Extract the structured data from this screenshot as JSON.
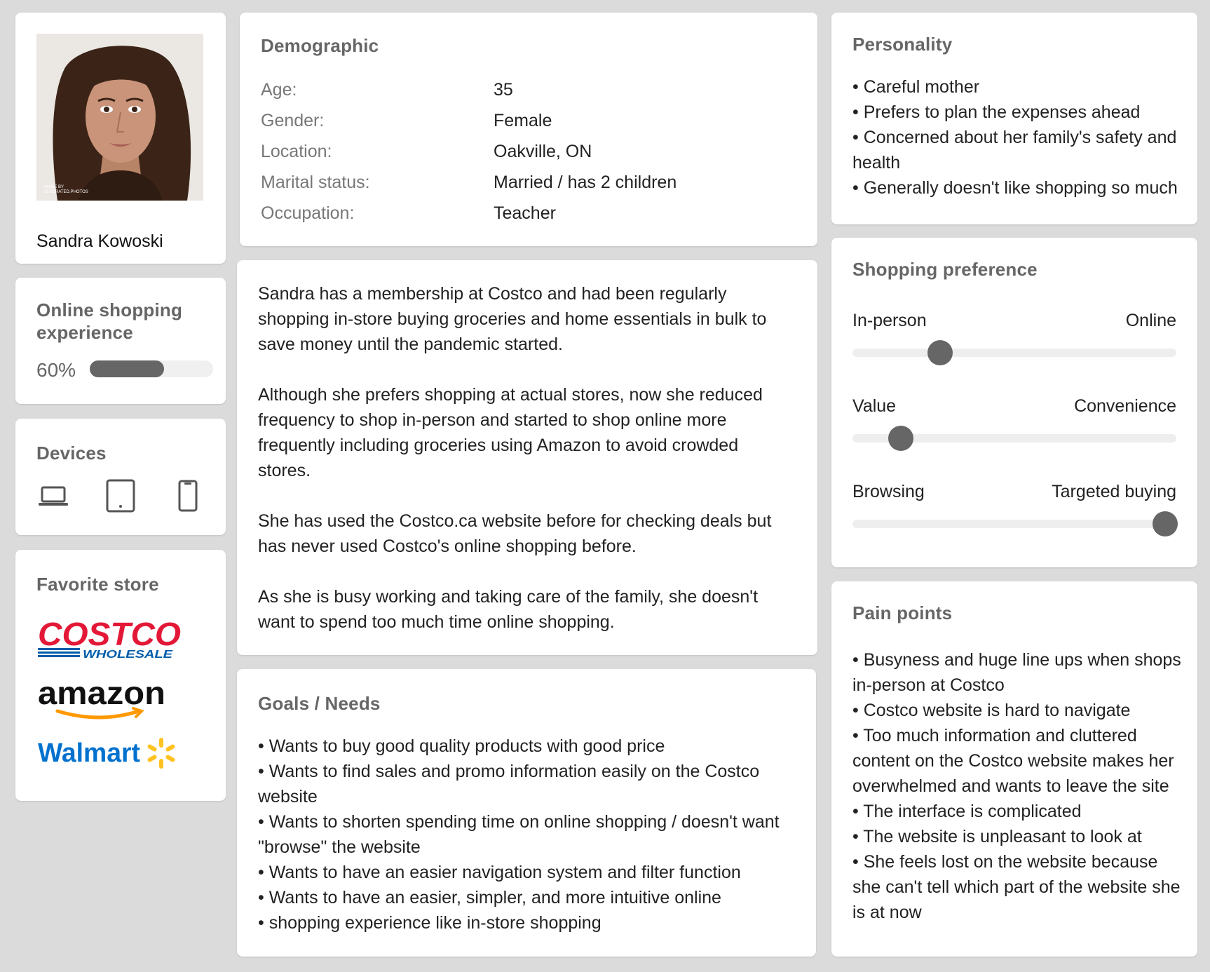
{
  "profile": {
    "name": "Sandra Kowoski",
    "photo_caption": "IMAGE BY GENERATED.PHOTOS"
  },
  "experience": {
    "title": "Online shopping experience",
    "value_label": "60%",
    "value": 0.6
  },
  "devices": {
    "title": "Devices",
    "icons": [
      "laptop-icon",
      "tablet-icon",
      "smartphone-icon"
    ]
  },
  "stores": {
    "title": "Favorite store",
    "logos": [
      {
        "name": "costco-logo",
        "text": "COSTCO",
        "subtext": "WHOLESALE",
        "color": "#e31837",
        "subcolor": "#005daa"
      },
      {
        "name": "amazon-logo",
        "text": "amazon",
        "color": "#111111",
        "accent": "#ff9900"
      },
      {
        "name": "walmart-logo",
        "text": "Walmart",
        "color": "#0071ce",
        "accent": "#ffc220"
      }
    ]
  },
  "demographic": {
    "title": "Demographic",
    "rows": [
      {
        "label": "Age:",
        "value": "35"
      },
      {
        "label": "Gender:",
        "value": "Female"
      },
      {
        "label": "Location:",
        "value": "Oakville, ON"
      },
      {
        "label": "Marital status:",
        "value": "Married / has 2 children"
      },
      {
        "label": "Occupation:",
        "value": "Teacher"
      }
    ]
  },
  "bio": {
    "paragraphs": [
      "Sandra has a membership at Costco and had been regularly shopping in-store buying groceries and home essentials in bulk to save money until the pandemic started.",
      "Although she prefers shopping at actual stores, now she reduced frequency to shop in-person and started to shop online more frequently including groceries using Amazon to avoid crowded stores.",
      "She has used the Costco.ca website before for checking deals but has never used Costco's online shopping before.",
      "As she is busy working and taking care of the family, she doesn't want to spend too much time online shopping."
    ]
  },
  "goals": {
    "title": "Goals / Needs",
    "items": [
      "• Wants to buy good quality products with good price",
      "• Wants to find sales and promo information easily on the Costco website",
      "• Wants to shorten spending time on online shopping / doesn't want \"browse\" the website",
      "• Wants to have an easier navigation system and filter function",
      "• Wants to have an easier, simpler, and more intuitive online",
      "• shopping experience like in-store shopping"
    ]
  },
  "personality": {
    "title": "Personality",
    "items": [
      "• Careful mother",
      "• Prefers to plan the expenses ahead",
      "• Concerned about her family's safety and health",
      "• Generally doesn't like shopping so much"
    ]
  },
  "preference": {
    "title": "Shopping preference",
    "scales": [
      {
        "left": "In-person",
        "right": "Online",
        "value": 0.27
      },
      {
        "left": "Value",
        "right": "Convenience",
        "value": 0.15
      },
      {
        "left": "Browsing",
        "right": "Targeted buying",
        "value": 0.965
      }
    ]
  },
  "pain_points": {
    "title": "Pain points",
    "items": [
      "• Busyness and huge line ups when shops in-person at Costco",
      "• Costco website is hard to navigate",
      "• Too much information and cluttered content on the Costco website makes her overwhelmed and wants to leave the site",
      "• The interface is complicated",
      "• The website is unpleasant to look at",
      "• She feels lost on the website because she can't tell which part of the website she is at now"
    ]
  }
}
